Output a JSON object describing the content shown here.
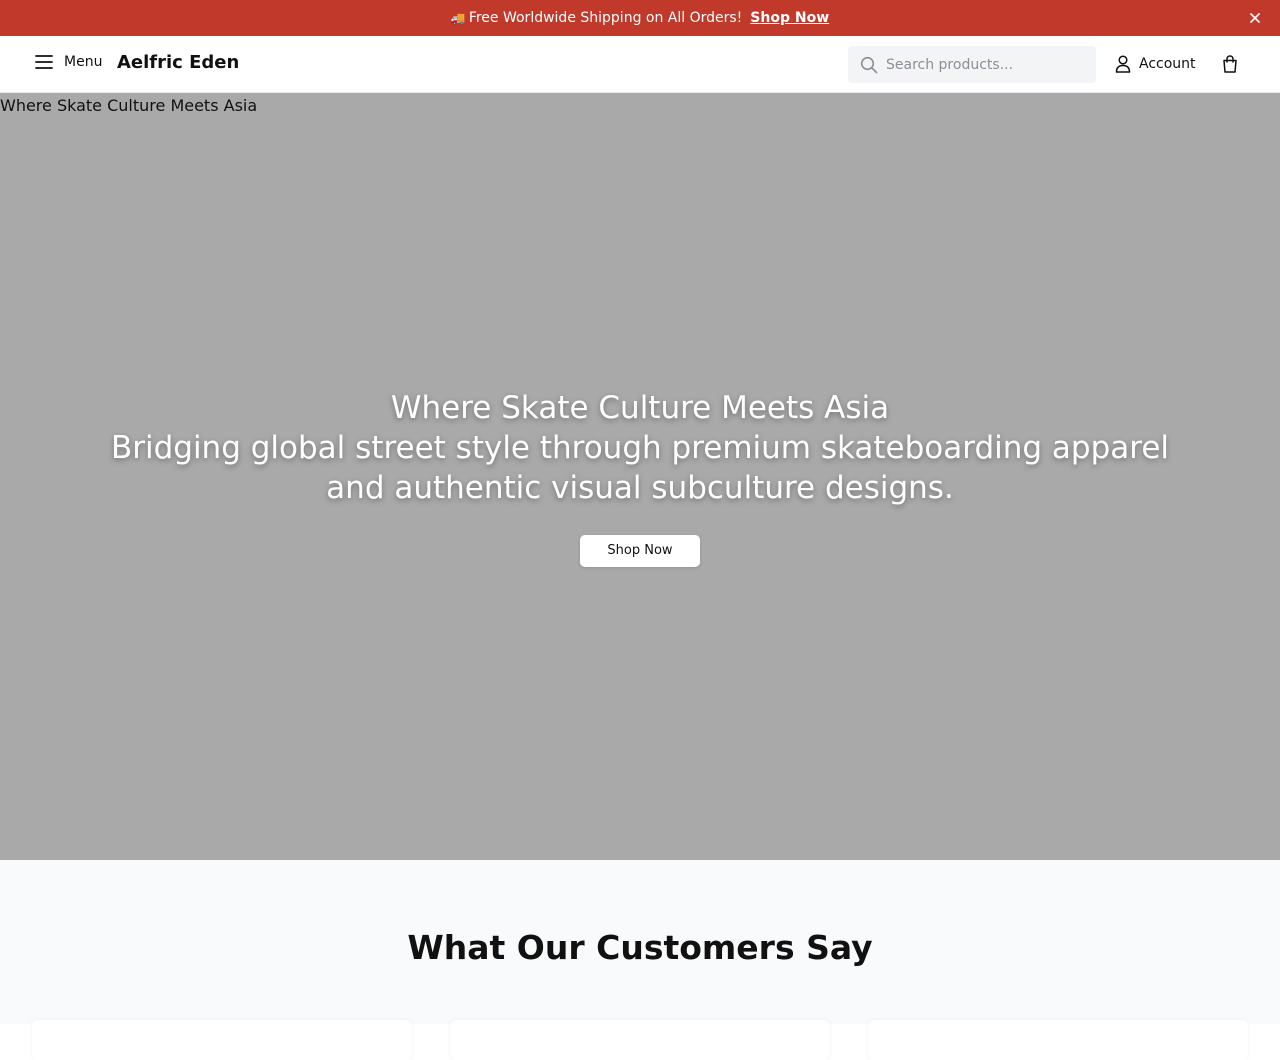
{
  "announcement": {
    "icon": "truck-icon",
    "text": "Free Worldwide Shipping on All Orders!",
    "link_label": "Shop Now"
  },
  "header": {
    "menu_label": "Menu",
    "brand": "Aelfric Eden",
    "search_placeholder": "Search products...",
    "account_label": "Account"
  },
  "hero": {
    "image_alt": "Where Skate Culture Meets Asia",
    "title": "Where Skate Culture Meets Asia",
    "subtitle": "Bridging global street style through premium skateboarding apparel and authentic visual subculture designs.",
    "button_label": "Shop Now",
    "background_color": "#a9a9a9"
  },
  "testimonials": {
    "heading": "What Our Customers Say"
  },
  "colors": {
    "announcement_bg": "#c0392b",
    "section_bg": "#f9fafb"
  }
}
